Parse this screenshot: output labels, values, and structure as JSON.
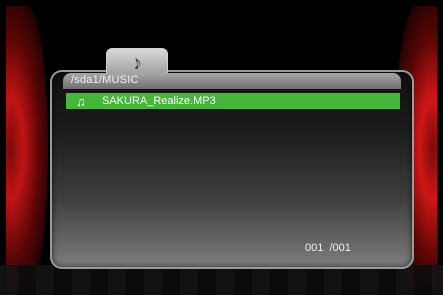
{
  "browser": {
    "path": "/sda1/MUSIC",
    "selected_file": "SAKURA_Realize.MP3",
    "counter": "001  /001"
  },
  "icons": {
    "folder_tab_icon": "music-note",
    "file_icon": "music-note"
  },
  "colors": {
    "bezel": "#c01414",
    "selection": "#46b53b"
  }
}
